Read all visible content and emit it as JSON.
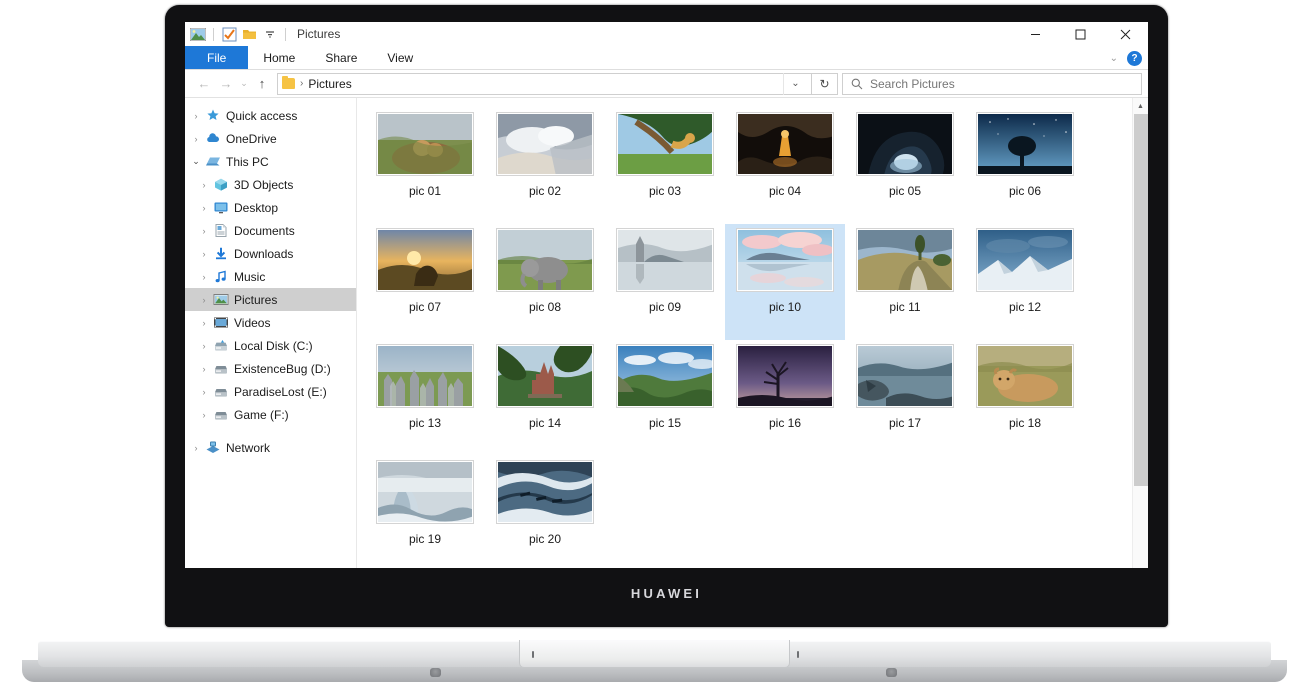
{
  "device": {
    "brand": "HUAWEI"
  },
  "window": {
    "title": "Pictures",
    "quick_access_icons": [
      "pictures-library-icon",
      "properties-icon",
      "new-folder-icon",
      "customize-dropdown-icon"
    ],
    "controls": {
      "minimize": "–",
      "maximize": "▢",
      "close": "✕"
    }
  },
  "ribbon": {
    "tabs": [
      "File",
      "Home",
      "Share",
      "View"
    ],
    "collapse_label": "⌄",
    "help_label": "?"
  },
  "nav": {
    "back": "←",
    "forward": "→",
    "recent": "⌄",
    "up": "↑",
    "breadcrumb_sep": "›",
    "path": "Pictures",
    "dropdown": "⌄",
    "refresh": "↻"
  },
  "search": {
    "placeholder": "Search Pictures",
    "icon": "search-icon"
  },
  "sidebar": {
    "items": [
      {
        "label": "Quick access",
        "level": 1,
        "icon": "star-pin-icon",
        "expanded": false,
        "selected": false
      },
      {
        "label": "OneDrive",
        "level": 1,
        "icon": "cloud-icon",
        "expanded": false,
        "selected": false
      },
      {
        "label": "This PC",
        "level": 1,
        "icon": "this-pc-icon",
        "expanded": true,
        "selected": false
      },
      {
        "label": "3D Objects",
        "level": 2,
        "icon": "3d-objects-icon",
        "expanded": false,
        "selected": false
      },
      {
        "label": "Desktop",
        "level": 2,
        "icon": "desktop-icon",
        "expanded": false,
        "selected": false
      },
      {
        "label": "Documents",
        "level": 2,
        "icon": "documents-icon",
        "expanded": false,
        "selected": false
      },
      {
        "label": "Downloads",
        "level": 2,
        "icon": "downloads-icon",
        "expanded": false,
        "selected": false
      },
      {
        "label": "Music",
        "level": 2,
        "icon": "music-icon",
        "expanded": false,
        "selected": false
      },
      {
        "label": "Pictures",
        "level": 2,
        "icon": "pictures-icon",
        "expanded": false,
        "selected": true
      },
      {
        "label": "Videos",
        "level": 2,
        "icon": "videos-icon",
        "expanded": false,
        "selected": false
      },
      {
        "label": "Local Disk (C:)",
        "level": 2,
        "icon": "system-drive-icon",
        "expanded": false,
        "selected": false
      },
      {
        "label": "ExistenceBug (D:)",
        "level": 2,
        "icon": "drive-icon",
        "expanded": false,
        "selected": false
      },
      {
        "label": "ParadiseLost (E:)",
        "level": 2,
        "icon": "drive-icon",
        "expanded": false,
        "selected": false
      },
      {
        "label": "Game (F:)",
        "level": 2,
        "icon": "drive-icon",
        "expanded": false,
        "selected": false
      },
      {
        "label": "Network",
        "level": 1,
        "icon": "network-icon",
        "expanded": false,
        "selected": false
      }
    ]
  },
  "files": [
    {
      "name": "pic 01",
      "selected": false,
      "checked": false,
      "art": "lion-cubs-grass"
    },
    {
      "name": "pic 02",
      "selected": false,
      "checked": false,
      "art": "clouds-snow-dune"
    },
    {
      "name": "pic 03",
      "selected": false,
      "checked": false,
      "art": "giraffe-tree"
    },
    {
      "name": "pic 04",
      "selected": false,
      "checked": false,
      "art": "cave-temple-night"
    },
    {
      "name": "pic 05",
      "selected": false,
      "checked": false,
      "art": "ice-cave-dark"
    },
    {
      "name": "pic 06",
      "selected": false,
      "checked": false,
      "art": "lone-tree-stars"
    },
    {
      "name": "pic 07",
      "selected": false,
      "checked": false,
      "art": "horse-sunset"
    },
    {
      "name": "pic 08",
      "selected": false,
      "checked": false,
      "art": "elephant-savanna"
    },
    {
      "name": "pic 09",
      "selected": false,
      "checked": false,
      "art": "church-lake-misty"
    },
    {
      "name": "pic 10",
      "selected": true,
      "checked": true,
      "art": "lake-pink-clouds"
    },
    {
      "name": "pic 11",
      "selected": false,
      "checked": false,
      "art": "road-hill-tree"
    },
    {
      "name": "pic 12",
      "selected": false,
      "checked": false,
      "art": "snow-mountain-ridge"
    },
    {
      "name": "pic 13",
      "selected": false,
      "checked": false,
      "art": "stone-forest"
    },
    {
      "name": "pic 14",
      "selected": false,
      "checked": false,
      "art": "castle-green-hills"
    },
    {
      "name": "pic 15",
      "selected": false,
      "checked": false,
      "art": "green-canyon"
    },
    {
      "name": "pic 16",
      "selected": false,
      "checked": false,
      "art": "bare-tree-dusk"
    },
    {
      "name": "pic 17",
      "selected": false,
      "checked": false,
      "art": "coastal-rocks"
    },
    {
      "name": "pic 18",
      "selected": false,
      "checked": false,
      "art": "lioness-grass"
    },
    {
      "name": "pic 19",
      "selected": false,
      "checked": false,
      "art": "frozen-waterfall"
    },
    {
      "name": "pic 20",
      "selected": false,
      "checked": false,
      "art": "ice-river-aerial"
    }
  ],
  "scrollbar": {
    "up": "▲",
    "down": "▼"
  },
  "colors": {
    "accent": "#1e78d7",
    "selection": "#cde3f7",
    "sidebar_selection": "#cfcfcf",
    "bezel": "#111113"
  }
}
